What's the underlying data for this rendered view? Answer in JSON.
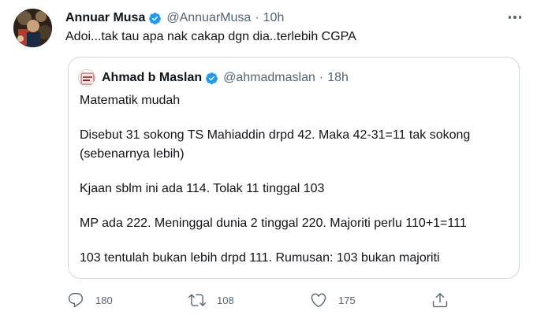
{
  "tweet": {
    "author_name": "Annuar Musa",
    "author_handle": "@AnnuarMusa",
    "separator": "·",
    "time": "10h",
    "text": "Adoi...tak tau apa nak cakap dgn dia..terlebih CGPA",
    "avatar_icon": "profile-photo",
    "verified_color": "#1d9bf0"
  },
  "quoted": {
    "author_name": "Ahmad b Maslan",
    "author_handle": "@ahmadmaslan",
    "separator": "·",
    "time": "18h",
    "lines": [
      "Matematik mudah",
      "Disebut 31 sokong TS Mahiaddin drpd 42. Maka 42-31=11 tak sokong",
      "(sebenarnya lebih)",
      "Kjaan sblm ini ada 114. Tolak 11 tinggal 103",
      "MP ada 222. Meninggal dunia 2 tinggal 220. Majoriti perlu 110+1=111",
      "103 tentulah bukan lebih drpd 111. Rumusan: 103 bukan majoriti"
    ]
  },
  "actions": {
    "reply_count": "180",
    "retweet_count": "108",
    "like_count": "175",
    "icons": [
      "reply-icon",
      "retweet-icon",
      "like-icon",
      "share-icon"
    ]
  },
  "colors": {
    "text": "#0f1419",
    "secondary": "#536471",
    "border": "#cfd9de",
    "verified": "#1d9bf0"
  }
}
